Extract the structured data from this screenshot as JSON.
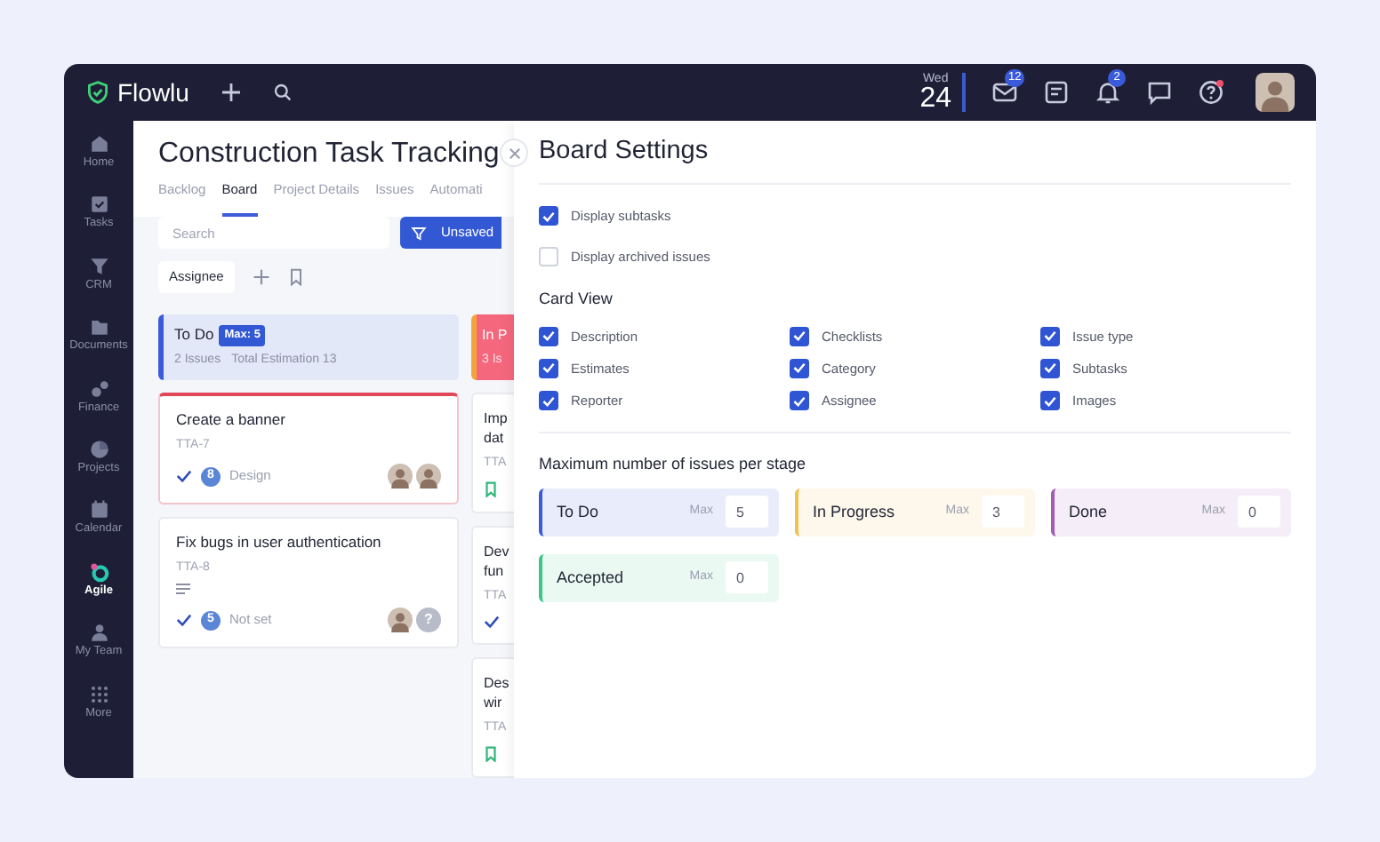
{
  "topbar": {
    "logo": "Flowlu",
    "day": "Wed",
    "date": "24",
    "icons": [
      {
        "kind": "mail",
        "badge": "12"
      },
      {
        "kind": "notes"
      },
      {
        "kind": "bell",
        "badge": "2"
      },
      {
        "kind": "chat"
      },
      {
        "kind": "help",
        "alert": true
      }
    ]
  },
  "sidebar": {
    "items": [
      {
        "kind": "home",
        "label": "Home",
        "selected": false
      },
      {
        "kind": "tasks",
        "label": "Tasks",
        "selected": false
      },
      {
        "kind": "crm",
        "label": "CRM",
        "selected": false
      },
      {
        "kind": "documents",
        "label": "Documents",
        "selected": false
      },
      {
        "kind": "finance",
        "label": "Finance",
        "selected": false
      },
      {
        "kind": "projects",
        "label": "Projects",
        "selected": false
      },
      {
        "kind": "calendar",
        "label": "Calendar",
        "selected": false
      },
      {
        "kind": "agile",
        "label": "Agile",
        "selected": true
      },
      {
        "kind": "team",
        "label": "My Team",
        "selected": false
      },
      {
        "kind": "more",
        "label": "More",
        "selected": false
      }
    ]
  },
  "project": {
    "title": "Construction Task Tracking",
    "tabs": [
      {
        "label": "Backlog",
        "selected": false
      },
      {
        "label": "Board",
        "selected": true
      },
      {
        "label": "Project Details",
        "selected": false
      },
      {
        "label": "Issues",
        "selected": false
      },
      {
        "label": "Automati",
        "selected": false
      }
    ]
  },
  "toolbar": {
    "search": {
      "placeholder": "Search"
    },
    "filter_button": "Unsaved",
    "assignee_button": "Assignee"
  },
  "columns": [
    {
      "title": "To Do",
      "badge": "Max: 5",
      "issues": "2 Issues",
      "estimation": "Total Estimation 13",
      "color": "#3b5bd9",
      "over_limit": false,
      "cards": [
        {
          "title_lines": [
            "Create a banner"
          ],
          "key": "TTA-7",
          "flagged": true,
          "has_description": false,
          "kind": "task",
          "points": "8",
          "category": "Design",
          "assignees": [
            {
              "kind": "photo"
            },
            {
              "kind": "photo"
            }
          ]
        },
        {
          "title_lines": [
            "Fix bugs in user authentication"
          ],
          "key": "TTA-8",
          "flagged": false,
          "has_description": true,
          "kind": "task",
          "points": "5",
          "category": "Not set",
          "assignees": [
            {
              "kind": "photo"
            },
            {
              "kind": "unknown",
              "label": "?"
            }
          ]
        }
      ]
    },
    {
      "title": "In P",
      "issues": "3 Is",
      "color": "#f3a53c",
      "over_limit": true,
      "cards": [
        {
          "title_lines": [
            "Imp",
            "dat"
          ],
          "key": "TTA",
          "flagged": false,
          "has_description": false,
          "kind": "story"
        },
        {
          "title_lines": [
            "Dev",
            "fun"
          ],
          "key": "TTA",
          "flagged": false,
          "has_description": false,
          "kind": "task"
        },
        {
          "title_lines": [
            "Des",
            "wir"
          ],
          "key": "TTA",
          "flagged": false,
          "has_description": false,
          "kind": "story"
        }
      ]
    }
  ],
  "settings": {
    "title": "Board Settings",
    "options": [
      {
        "label": "Display subtasks",
        "checked": true
      },
      {
        "label": "Display archived issues",
        "checked": false
      }
    ],
    "card_view": {
      "heading": "Card View",
      "options": [
        {
          "label": "Description",
          "checked": true
        },
        {
          "label": "Checklists",
          "checked": true
        },
        {
          "label": "Issue type",
          "checked": true
        },
        {
          "label": "Estimates",
          "checked": true
        },
        {
          "label": "Category",
          "checked": true
        },
        {
          "label": "Subtasks",
          "checked": true
        },
        {
          "label": "Reporter",
          "checked": true
        },
        {
          "label": "Assignee",
          "checked": true
        },
        {
          "label": "Images",
          "checked": true
        }
      ]
    },
    "limits": {
      "heading": "Maximum number of issues per stage",
      "stages": [
        {
          "name": "To Do",
          "max_label": "Max",
          "value": "5",
          "color": "#3b5bd9"
        },
        {
          "name": "In Progress",
          "max_label": "Max",
          "value": "3",
          "color": "#f2c14e"
        },
        {
          "name": "Done",
          "max_label": "Max",
          "value": "0",
          "color": "#a35bb5"
        },
        {
          "name": "Accepted",
          "max_label": "Max",
          "value": "0",
          "color": "#3cc68a"
        }
      ]
    }
  }
}
